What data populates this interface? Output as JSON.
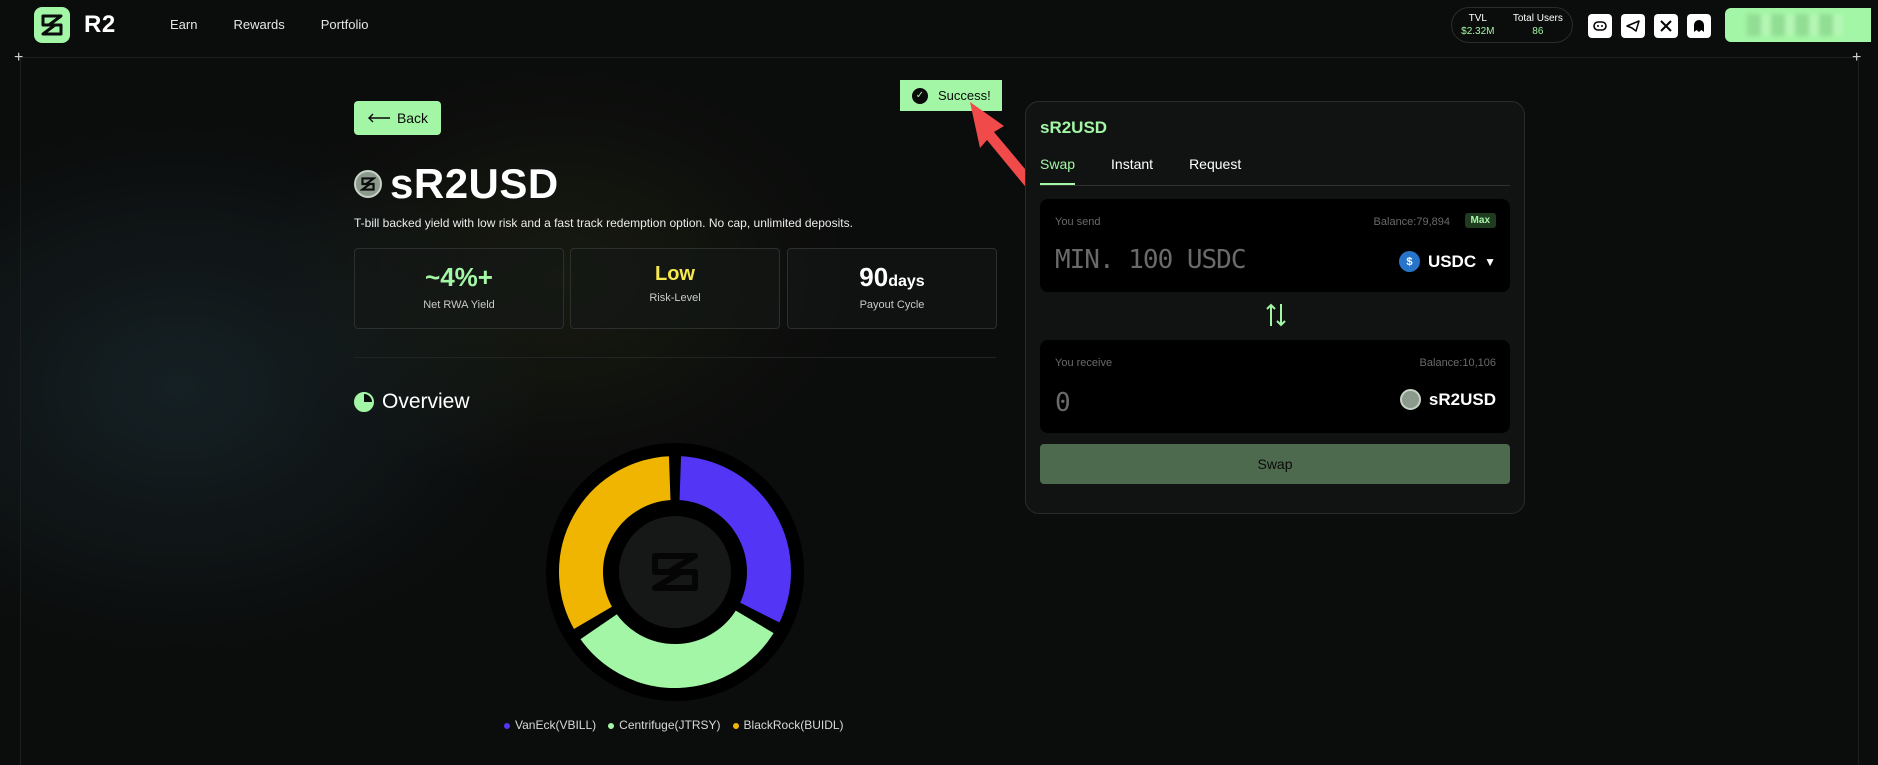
{
  "nav": {
    "brand": "R2",
    "links": [
      "Earn",
      "Rewards",
      "Portfolio"
    ],
    "stats": {
      "tvl_label": "TVL",
      "tvl_value": "$2.32M",
      "users_label": "Total Users",
      "users_value": "86"
    },
    "socials": [
      "discord-icon",
      "telegram-icon",
      "x-icon",
      "ghost-icon"
    ]
  },
  "toast": {
    "text": "Success!"
  },
  "back_label": "Back",
  "product": {
    "title": "sR2USD",
    "description": "T-bill backed yield with low risk and a fast track redemption option. No cap, unlimited deposits.",
    "cards": [
      {
        "value": "~4%+",
        "unit": "",
        "label": "Net RWA Yield"
      },
      {
        "value": "Low",
        "unit": "",
        "label": "Risk-Level"
      },
      {
        "value": "90",
        "unit": "days",
        "label": "Payout Cycle"
      }
    ]
  },
  "overview": {
    "title": "Overview",
    "chart_data": {
      "type": "pie",
      "series": [
        {
          "name": "VanEck(VBILL)",
          "value": 33,
          "color": "#5235f5"
        },
        {
          "name": "Centrifuge(JTRSY)",
          "value": 33,
          "color": "#a3f6a5"
        },
        {
          "name": "BlackRock(BUIDL)",
          "value": 34,
          "color": "#f0b500"
        }
      ]
    }
  },
  "swap": {
    "title": "sR2USD",
    "tabs": [
      "Swap",
      "Instant",
      "Request"
    ],
    "active_tab": "Swap",
    "send": {
      "label": "You send",
      "balance": "Balance:79,894",
      "max_label": "Max",
      "placeholder": "MIN. 100 USDC",
      "asset": "USDC"
    },
    "receive": {
      "label": "You receive",
      "balance": "Balance:10,106",
      "amount": "0",
      "asset": "sR2USD"
    },
    "button_label": "Swap"
  },
  "colors": {
    "accent": "#a3f6a5",
    "background": "#0b0c0c",
    "risk": "#f5e94d"
  }
}
